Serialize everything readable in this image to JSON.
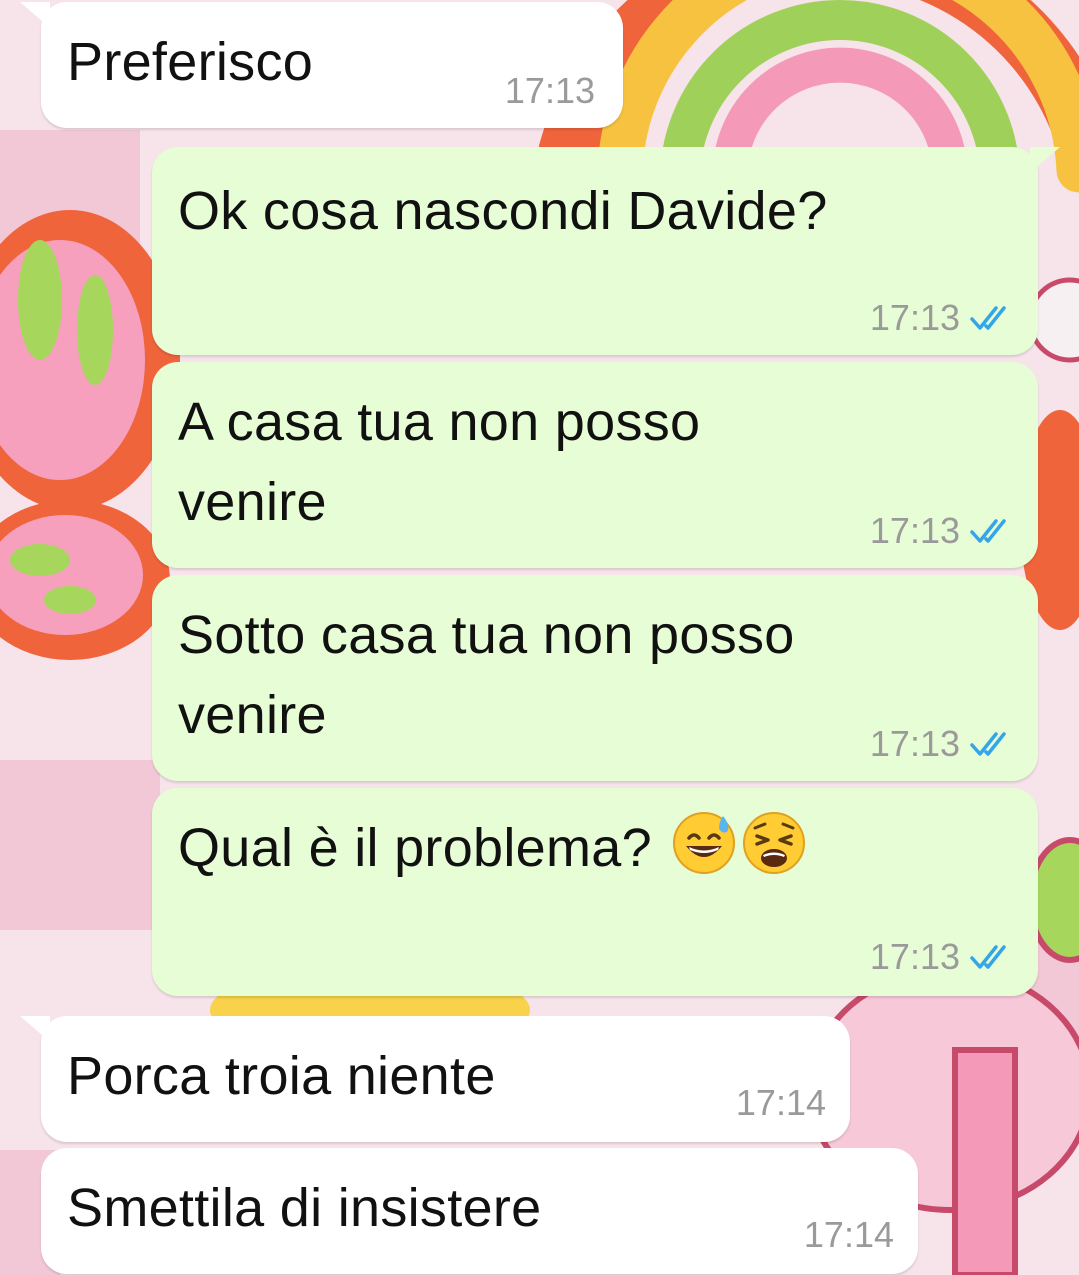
{
  "chat": {
    "messages": [
      {
        "direction": "incoming",
        "text": "Preferisco",
        "time": "17:13"
      },
      {
        "direction": "outgoing",
        "text": "Ok cosa nascondi Davide?",
        "time": "17:13",
        "status": "read"
      },
      {
        "direction": "outgoing",
        "line1": "A casa tua non posso",
        "line2": "venire",
        "time": "17:13",
        "status": "read"
      },
      {
        "direction": "outgoing",
        "line1": "Sotto casa tua non posso",
        "line2": "venire",
        "time": "17:13",
        "status": "read"
      },
      {
        "direction": "outgoing",
        "text": "Qual è il problema?",
        "emojis": [
          "grinning-face-with-sweat",
          "weary-face"
        ],
        "time": "17:13",
        "status": "read"
      },
      {
        "direction": "incoming",
        "text": "Porca troia niente",
        "time": "17:14"
      },
      {
        "direction": "incoming",
        "text": "Smettila di insistere",
        "time": "17:14"
      }
    ]
  },
  "colors": {
    "incoming_bubble": "#ffffff",
    "outgoing_bubble": "#e7fdd6",
    "read_ticks": "#34a6e8",
    "timestamp": "#9a9a9a"
  }
}
